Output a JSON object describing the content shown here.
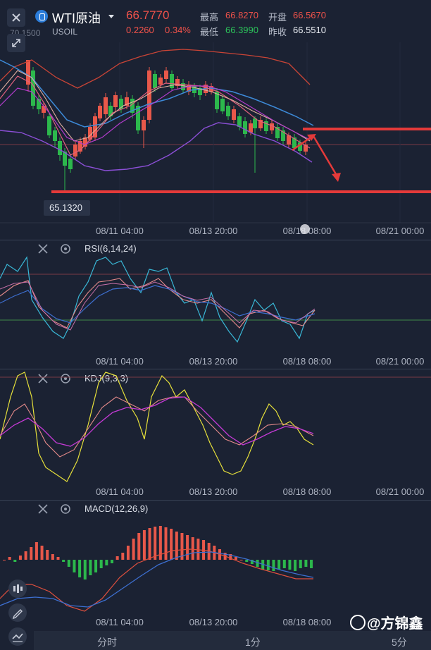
{
  "header": {
    "close_icon": "close-icon",
    "instrument_name": "WTI原油",
    "instrument_code": "USOIL",
    "price": "66.7770",
    "change": "0.2260",
    "change_pct": "0.34%",
    "high_label": "最高",
    "high_value": "66.8270",
    "open_label": "开盘",
    "open_value": "66.5670",
    "low_label": "最低",
    "low_value": "66.3990",
    "prev_close_label": "昨收",
    "prev_close_value": "66.5510",
    "axis_top_value": "70.1500"
  },
  "main_chart": {
    "low_marker": "65.1320",
    "x_labels": [
      "08/11 04:00",
      "08/13 20:00",
      "08/18 08:00",
      "08/21 00:00"
    ]
  },
  "rsi_panel": {
    "title": "RSI(6,14,24)",
    "x_labels": [
      "08/11 04:00",
      "08/13 20:00",
      "08/18 08:00",
      "08/21 00:00"
    ]
  },
  "kdj_panel": {
    "title": "KDJ(9,3,3)",
    "x_labels": [
      "08/11 04:00",
      "08/13 20:00",
      "08/18 08:00",
      "08/21 00:00"
    ]
  },
  "macd_panel": {
    "title": "MACD(12,26,9)",
    "x_labels": [
      "08/11 04:00",
      "08/13 20:00",
      "08/18 08:00"
    ]
  },
  "bottom_bar": {
    "tabs": [
      "分时",
      "1分",
      "5分"
    ]
  },
  "watermark": "@方锦鑫",
  "colors": {
    "up": "#e8584a",
    "down": "#2cb84c",
    "accent_red": "#e43a3a",
    "background": "#1b2233"
  }
}
